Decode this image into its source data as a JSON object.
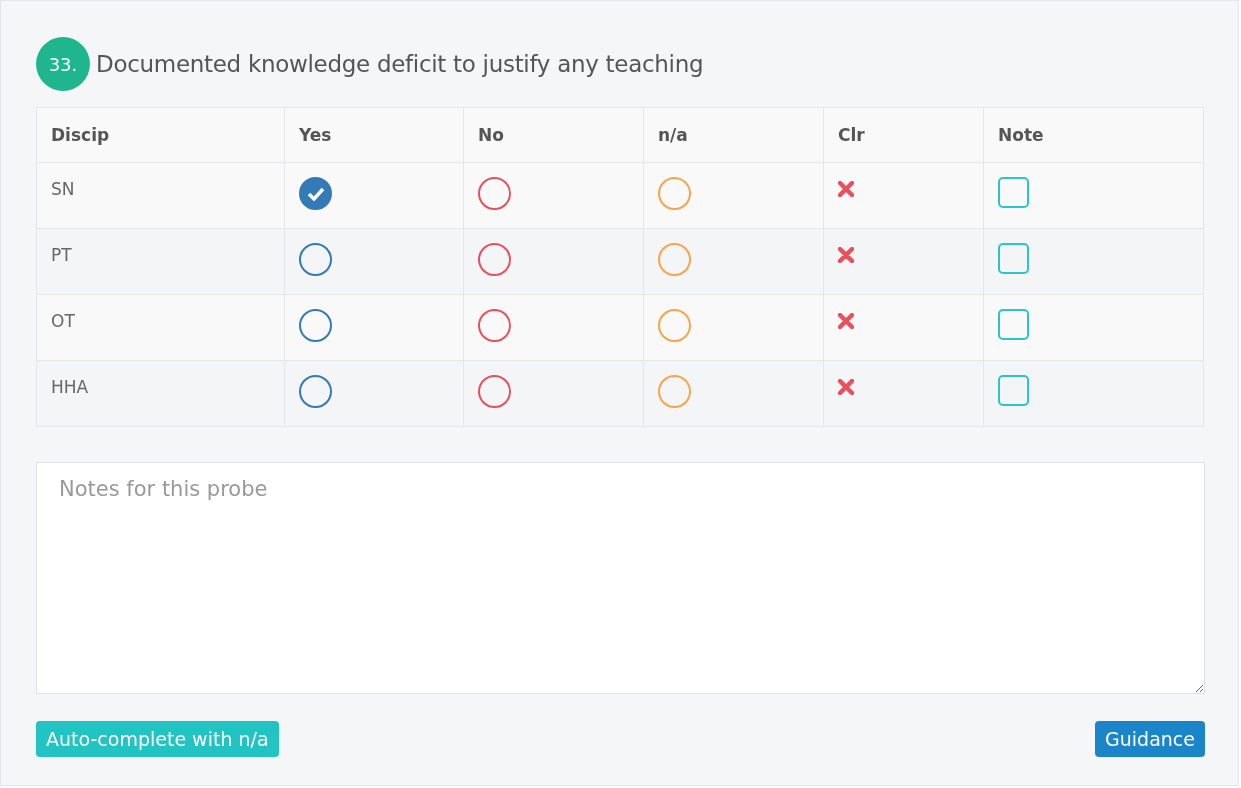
{
  "question": {
    "number": "33.",
    "title": "Documented knowledge deficit to justify any teaching"
  },
  "table": {
    "columns": [
      "Discip",
      "Yes",
      "No",
      "n/a",
      "Clr",
      "Note"
    ],
    "rows": [
      {
        "discipline": "SN",
        "options": [
          {
            "kind": "yes",
            "selected": true
          },
          {
            "kind": "no",
            "selected": false
          },
          {
            "kind": "na",
            "selected": false
          }
        ],
        "note_checked": false
      },
      {
        "discipline": "PT",
        "options": [
          {
            "kind": "yes",
            "selected": false
          },
          {
            "kind": "no",
            "selected": false
          },
          {
            "kind": "na",
            "selected": false
          }
        ],
        "note_checked": false
      },
      {
        "discipline": "OT",
        "options": [
          {
            "kind": "yes",
            "selected": false
          },
          {
            "kind": "no",
            "selected": false
          },
          {
            "kind": "na",
            "selected": false
          }
        ],
        "note_checked": false
      },
      {
        "discipline": "HHA",
        "options": [
          {
            "kind": "yes",
            "selected": false
          },
          {
            "kind": "no",
            "selected": false
          },
          {
            "kind": "na",
            "selected": false
          }
        ],
        "note_checked": false
      }
    ]
  },
  "notes": {
    "placeholder": "Notes for this probe"
  },
  "buttons": [
    {
      "kind": "autocomplete",
      "label": "Auto-complete with n/a"
    },
    {
      "kind": "guidance",
      "label": "Guidance"
    }
  ]
}
